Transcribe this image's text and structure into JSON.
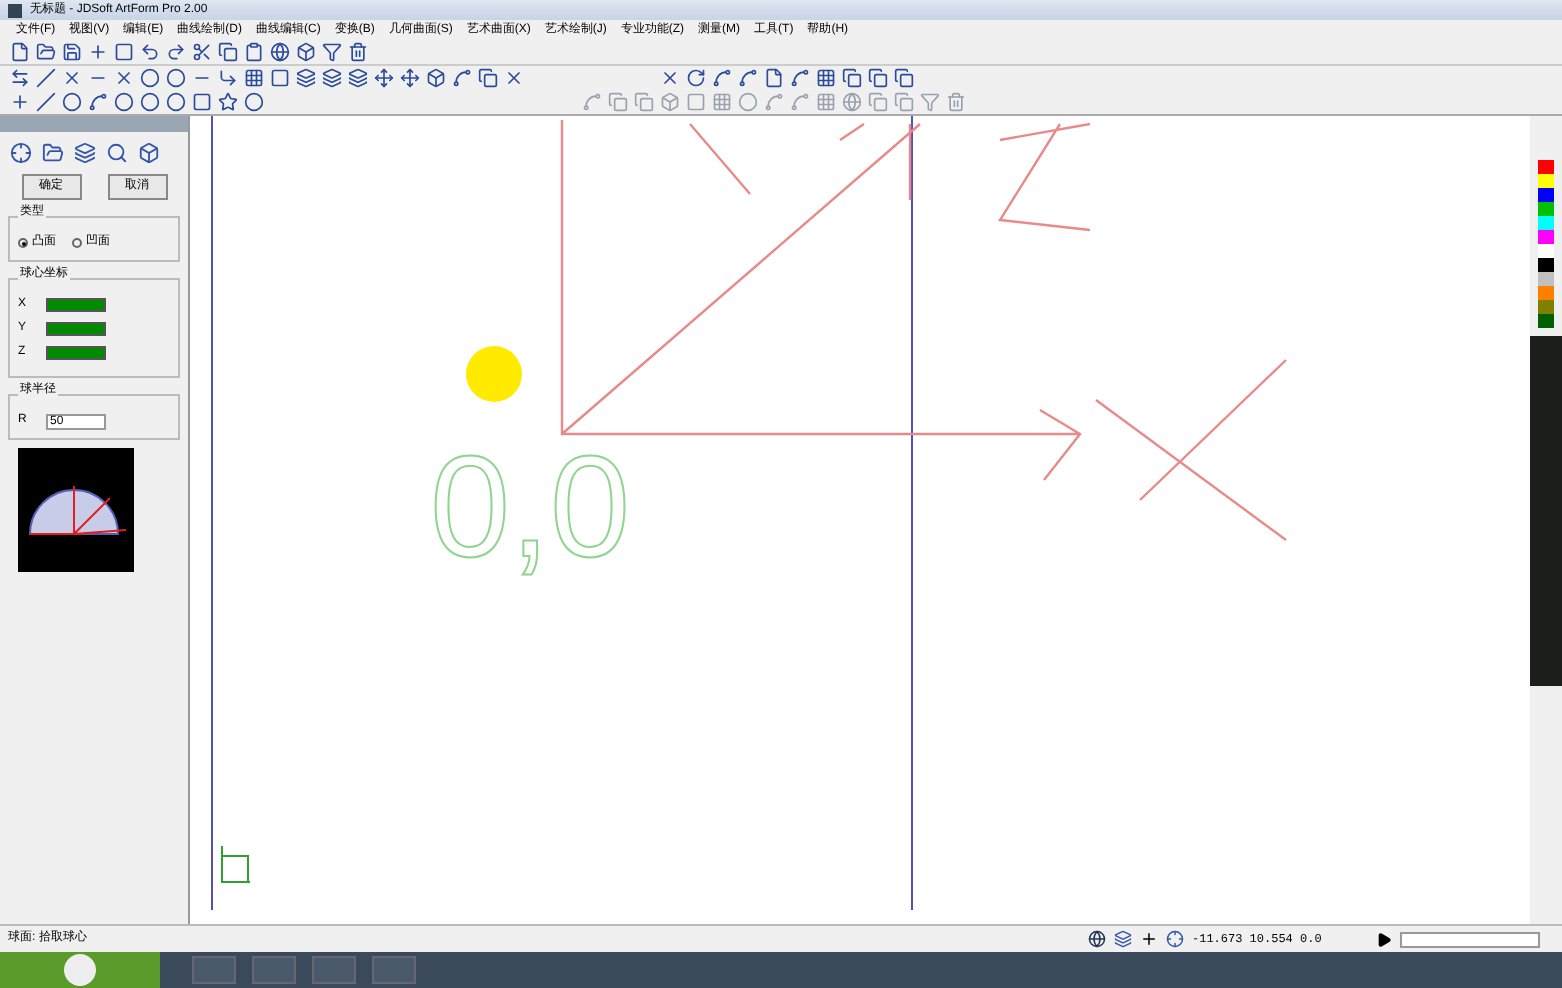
{
  "window": {
    "title": "无标题 - JDSoft ArtForm Pro 2.00"
  },
  "menu": [
    "文件(F)",
    "视图(V)",
    "编辑(E)",
    "曲线绘制(D)",
    "曲线编辑(C)",
    "变换(B)",
    "几何曲面(S)",
    "艺术曲面(X)",
    "艺术绘制(J)",
    "专业功能(Z)",
    "测量(M)",
    "工具(T)",
    "帮助(H)"
  ],
  "panel": {
    "buttons": [
      "确定",
      "取消"
    ],
    "type_group": {
      "title": "类型",
      "options": [
        {
          "label": "凸面",
          "selected": true
        },
        {
          "label": "凹面",
          "selected": false
        }
      ]
    },
    "center_group": {
      "title": "球心坐标",
      "fields": [
        {
          "label": "X"
        },
        {
          "label": "Y"
        },
        {
          "label": "Z"
        }
      ]
    },
    "radius_group": {
      "title": "球半径",
      "label": "R",
      "value": "50"
    }
  },
  "canvas": {
    "origin_label": "0,0"
  },
  "palette": [
    {
      "color": "#ff0000"
    },
    {
      "color": "#ffff00"
    },
    {
      "color": "#0000ff"
    },
    {
      "color": "#00c000"
    },
    {
      "color": "#00ffff"
    },
    {
      "color": "#ff00ff"
    },
    {
      "color": "#ffffff"
    },
    {
      "color": "#000000"
    },
    {
      "color": "#c0c0c0"
    },
    {
      "color": "#ff8000"
    },
    {
      "color": "#808000"
    },
    {
      "color": "#006000"
    }
  ],
  "status_bar": {
    "message": "球面: 拾取球心",
    "coordinates": "-11.673 10.554 0.0"
  }
}
